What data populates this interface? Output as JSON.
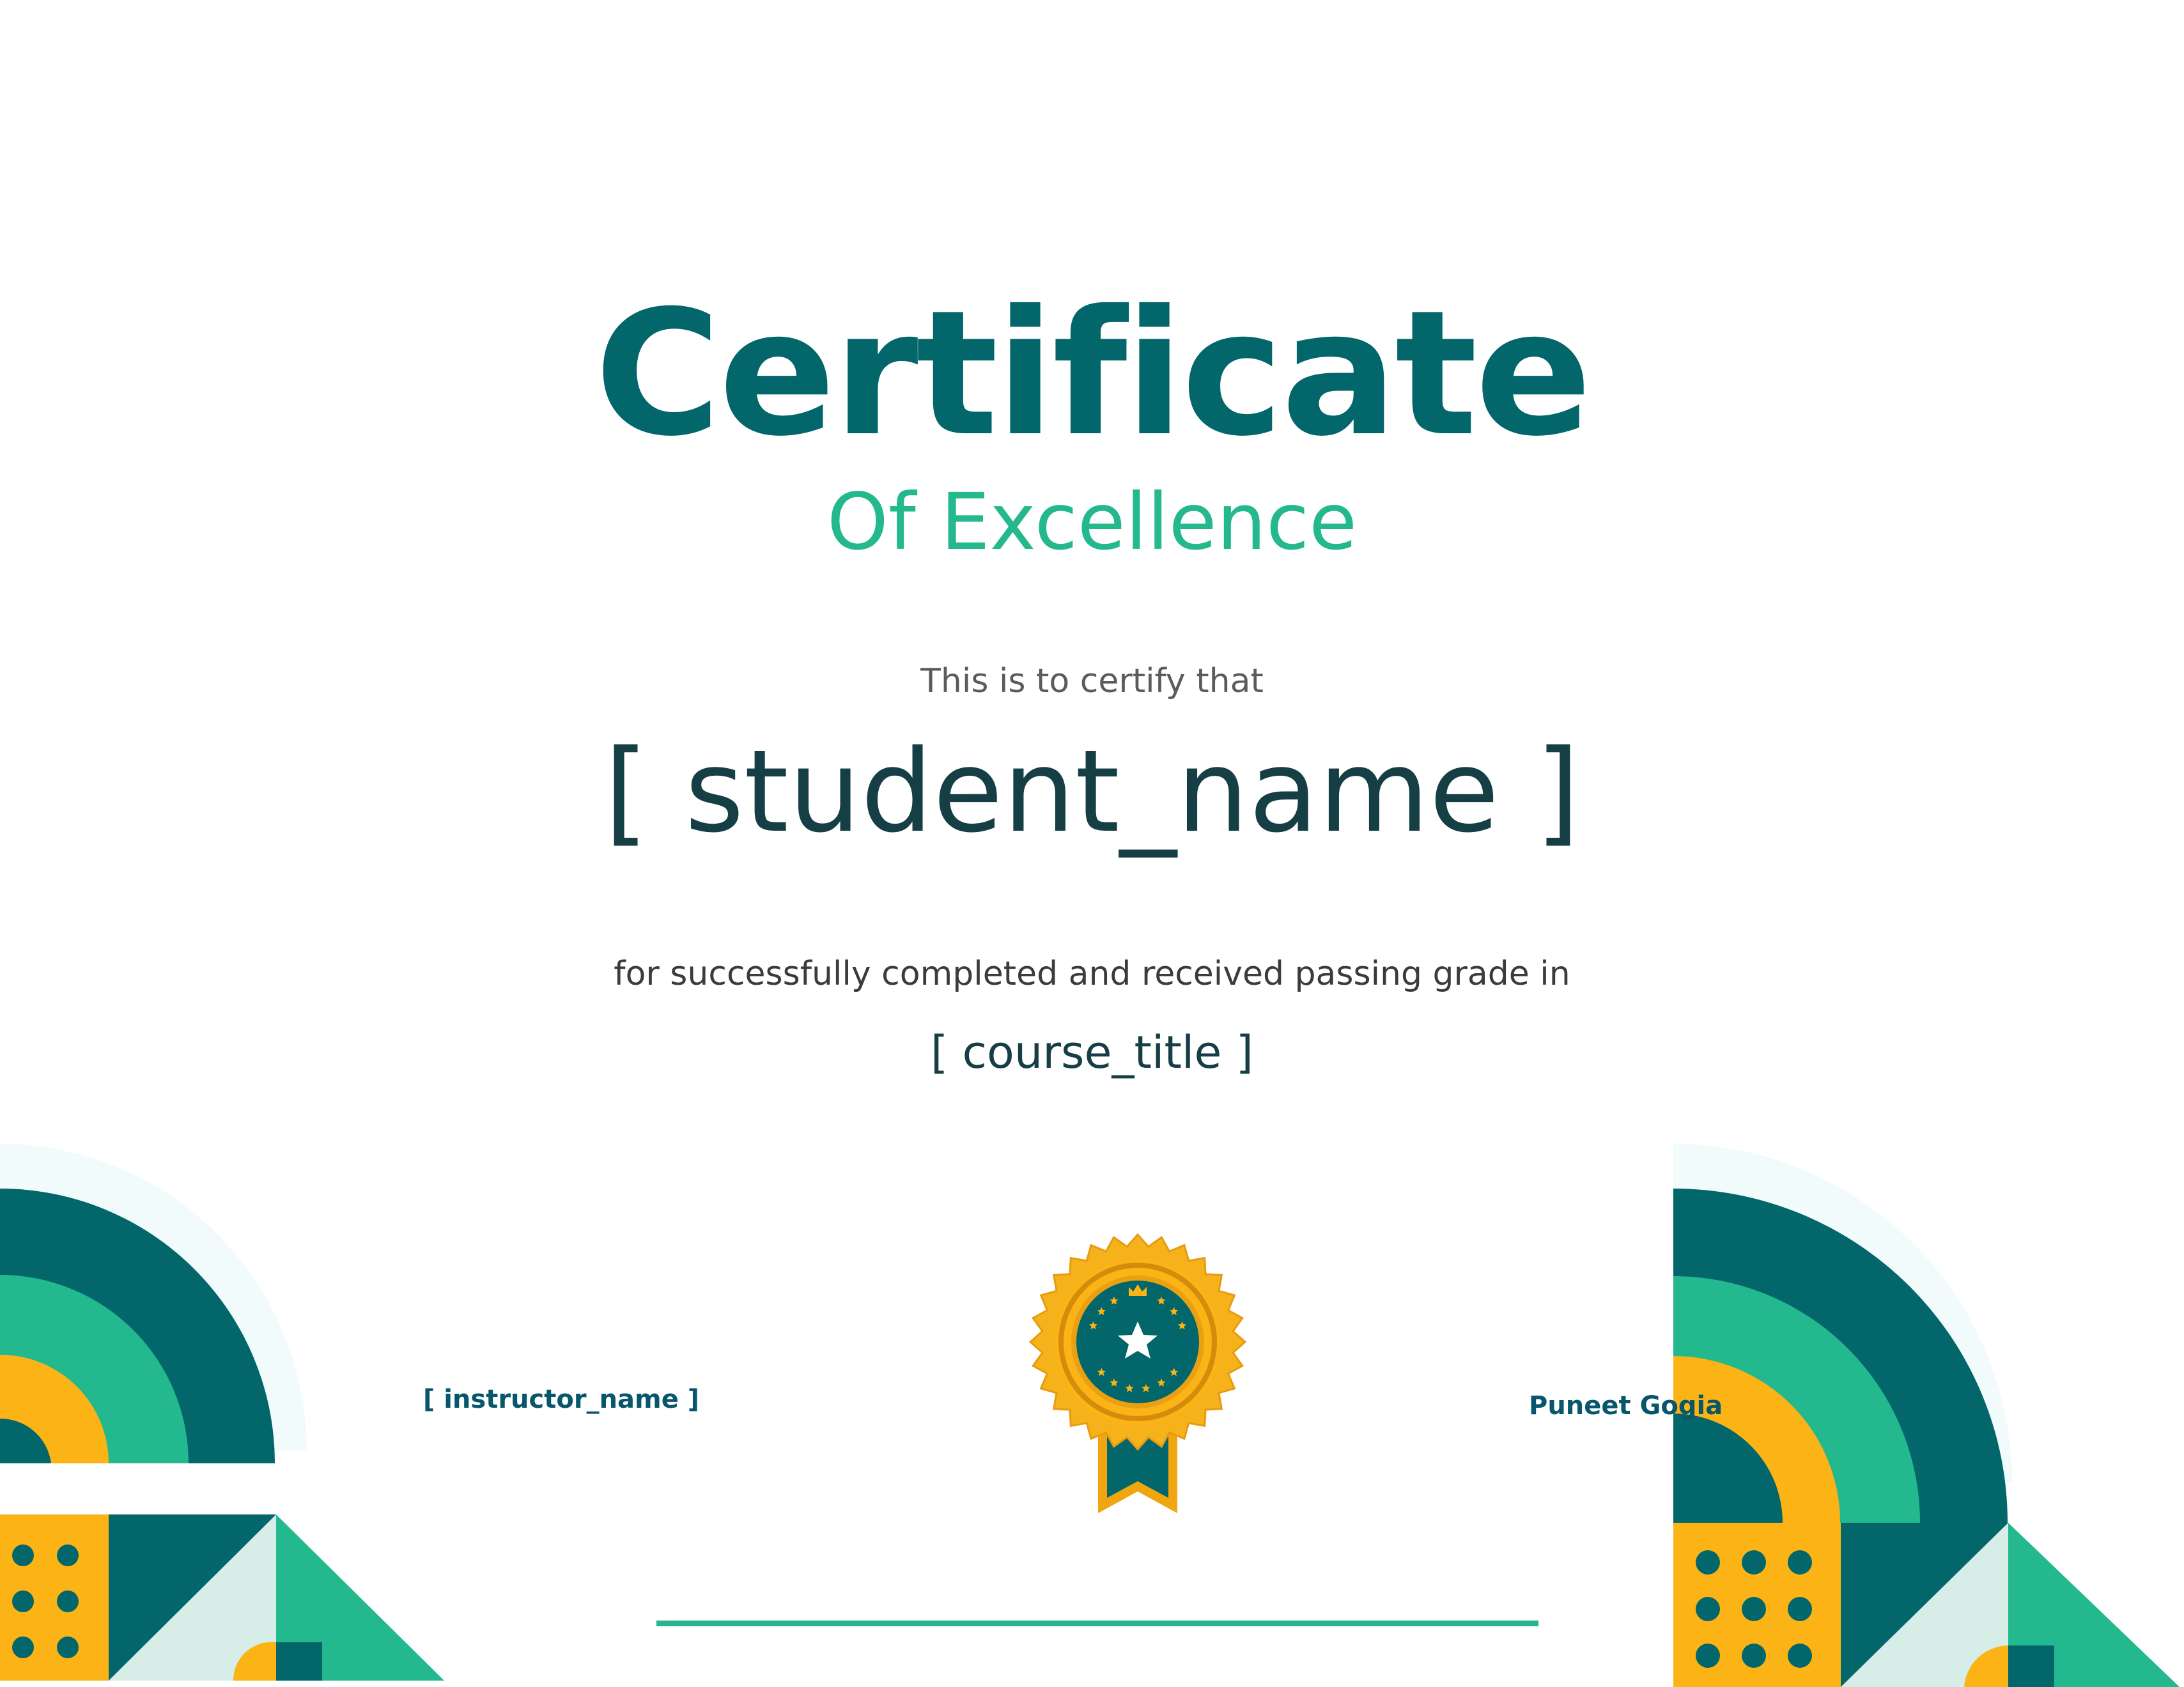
{
  "certificate": {
    "title": "Certificate",
    "subtitle": "Of Excellence",
    "certify_text": "This is to certify that",
    "student_placeholder": "[ student_name ]",
    "completion_text": "for successfully completed and received passing grade in",
    "course_placeholder": "[ course_title ]"
  },
  "signatures": {
    "instructor_placeholder": "[ instructor_name ]",
    "signer_name": "Puneet Gogia"
  },
  "colors": {
    "teal_dark": "#02666b",
    "green": "#24b88f",
    "amber": "#fbb316",
    "ink": "#163f45"
  },
  "icons": {
    "seal": "award-seal-icon",
    "star": "star-icon",
    "crown": "crown-icon"
  }
}
